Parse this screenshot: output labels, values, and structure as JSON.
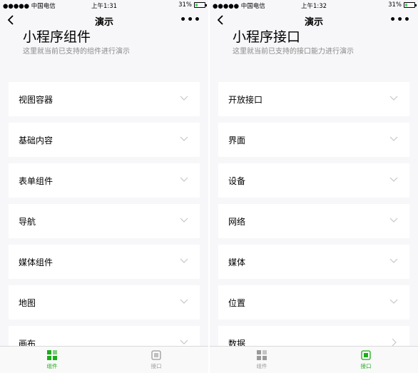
{
  "left": {
    "status": {
      "carrier": "●●●●● 中国电信",
      "time": "上午1:31",
      "battery": "31%",
      "battery_level": 0.31
    },
    "nav": {
      "title": "演示",
      "more": "•••"
    },
    "heading": {
      "title": "小程序组件",
      "desc": "这里就当前已支持的组件进行演示"
    },
    "items": [
      {
        "label": "视图容器"
      },
      {
        "label": "基础内容"
      },
      {
        "label": "表单组件"
      },
      {
        "label": "导航"
      },
      {
        "label": "媒体组件"
      },
      {
        "label": "地图"
      },
      {
        "label": "画布"
      }
    ],
    "tabs": [
      {
        "label": "组件",
        "active": true
      },
      {
        "label": "接口",
        "active": false
      }
    ]
  },
  "right": {
    "status": {
      "carrier": "●●●●● 中国电信",
      "time": "上午1:32",
      "battery": "31%",
      "battery_level": 0.31
    },
    "nav": {
      "title": "演示",
      "more": "•••"
    },
    "heading": {
      "title": "小程序接口",
      "desc": "这里就当前已支持的接口能力进行演示"
    },
    "items": [
      {
        "label": "开放接口"
      },
      {
        "label": "界面"
      },
      {
        "label": "设备"
      },
      {
        "label": "网络"
      },
      {
        "label": "媒体"
      },
      {
        "label": "位置"
      },
      {
        "label": "数据"
      }
    ],
    "tabs": [
      {
        "label": "组件",
        "active": false
      },
      {
        "label": "接口",
        "active": true
      }
    ]
  },
  "colors": {
    "accent": "#1aad19",
    "inactive": "#9a9a9a",
    "background": "#f7f7fa"
  }
}
